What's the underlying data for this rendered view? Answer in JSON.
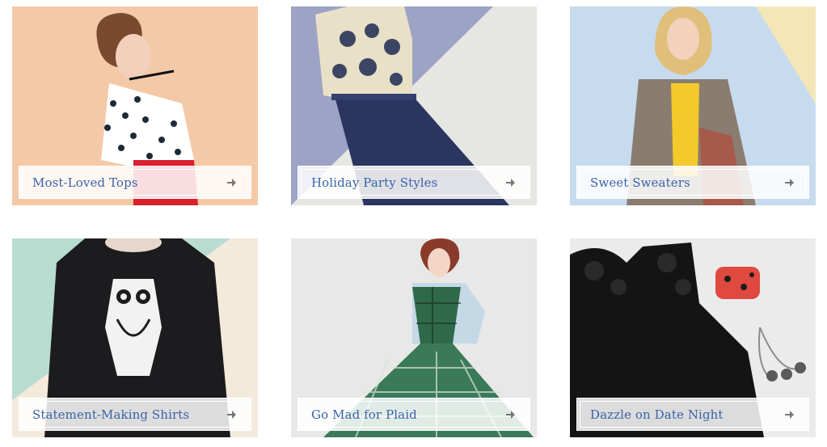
{
  "tiles": [
    {
      "label": "Most-Loved Tops",
      "icon": "arrow-right-icon"
    },
    {
      "label": "Holiday Party Styles",
      "icon": "arrow-right-icon"
    },
    {
      "label": "Sweet Sweaters",
      "icon": "arrow-right-icon"
    },
    {
      "label": "Statement-Making Shirts",
      "icon": "arrow-right-icon"
    },
    {
      "label": "Go Mad for Plaid",
      "icon": "arrow-right-icon"
    },
    {
      "label": "Dazzle on Date Night",
      "icon": "arrow-right-icon"
    }
  ],
  "colors": {
    "label_text": "#3a63a8",
    "arrow": "#777777"
  }
}
